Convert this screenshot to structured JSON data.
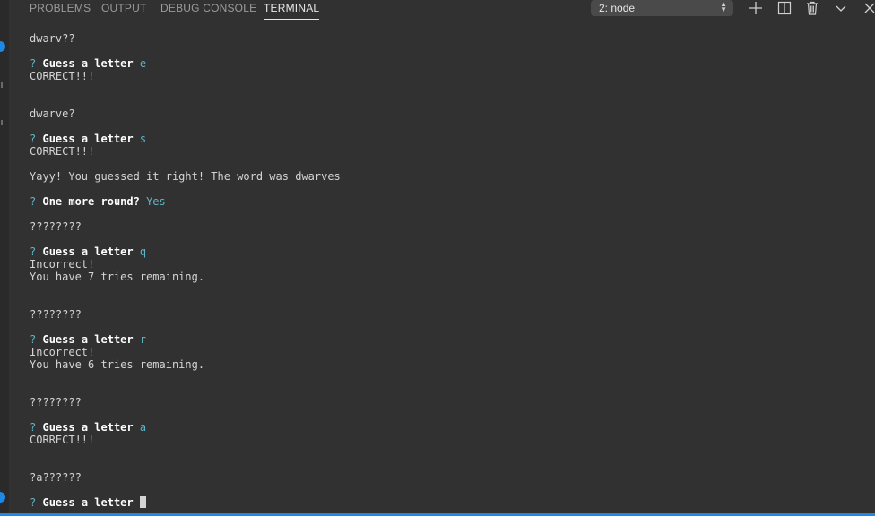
{
  "tabs": [
    {
      "label": "PROBLEMS"
    },
    {
      "label": "OUTPUT"
    },
    {
      "label": "DEBUG CONSOLE"
    },
    {
      "label": "TERMINAL"
    }
  ],
  "terminal_selector": {
    "value": "2: node"
  },
  "toolbar_icons": [
    "plus-icon",
    "split-icon",
    "trash-icon",
    "chevron-down-icon",
    "close-icon"
  ],
  "terminal": {
    "blocks": [
      {
        "word": "dwarv??",
        "prompt": "Guess a letter",
        "answer": "e",
        "result": "CORRECT!!!"
      },
      {
        "word": "dwarve?",
        "prompt": "Guess a letter",
        "answer": "s",
        "result": "CORRECT!!!"
      },
      {
        "win": "Yayy! You guessed it right! The word was dwarves"
      },
      {
        "prompt": "One more round?",
        "answer": "Yes"
      },
      {
        "word": "????????",
        "prompt": "Guess a letter",
        "answer": "q",
        "result": "Incorrect!",
        "tries": "You have 7 tries remaining."
      },
      {
        "word": "????????",
        "prompt": "Guess a letter",
        "answer": "r",
        "result": "Incorrect!",
        "tries": "You have 6 tries remaining."
      },
      {
        "word": "????????",
        "prompt": "Guess a letter",
        "answer": "a",
        "result": "CORRECT!!!"
      },
      {
        "word": "?a??????",
        "prompt": "Guess a letter"
      }
    ],
    "prompt_marker": "?"
  },
  "colors": {
    "accent": "#1e88e5",
    "answer": "#5fb3c6",
    "background": "#313131"
  }
}
